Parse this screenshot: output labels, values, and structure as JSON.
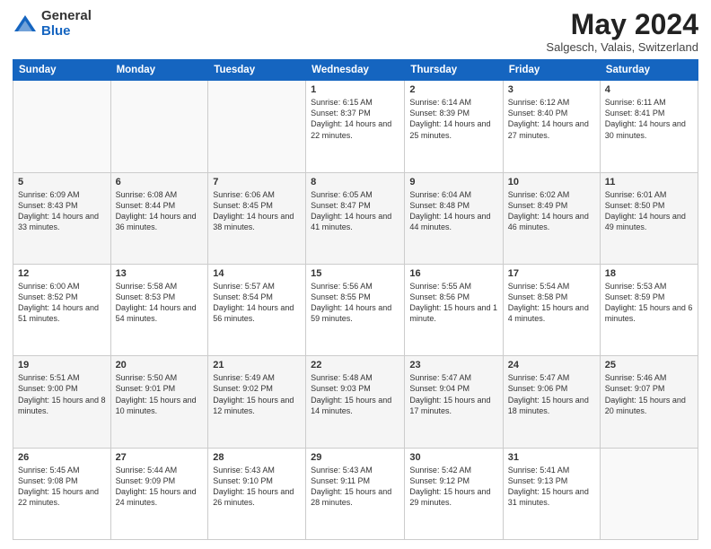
{
  "header": {
    "logo_general": "General",
    "logo_blue": "Blue",
    "month_title": "May 2024",
    "location": "Salgesch, Valais, Switzerland"
  },
  "days_of_week": [
    "Sunday",
    "Monday",
    "Tuesday",
    "Wednesday",
    "Thursday",
    "Friday",
    "Saturday"
  ],
  "weeks": [
    [
      {
        "day": "",
        "info": ""
      },
      {
        "day": "",
        "info": ""
      },
      {
        "day": "",
        "info": ""
      },
      {
        "day": "1",
        "info": "Sunrise: 6:15 AM\nSunset: 8:37 PM\nDaylight: 14 hours\nand 22 minutes."
      },
      {
        "day": "2",
        "info": "Sunrise: 6:14 AM\nSunset: 8:39 PM\nDaylight: 14 hours\nand 25 minutes."
      },
      {
        "day": "3",
        "info": "Sunrise: 6:12 AM\nSunset: 8:40 PM\nDaylight: 14 hours\nand 27 minutes."
      },
      {
        "day": "4",
        "info": "Sunrise: 6:11 AM\nSunset: 8:41 PM\nDaylight: 14 hours\nand 30 minutes."
      }
    ],
    [
      {
        "day": "5",
        "info": "Sunrise: 6:09 AM\nSunset: 8:43 PM\nDaylight: 14 hours\nand 33 minutes."
      },
      {
        "day": "6",
        "info": "Sunrise: 6:08 AM\nSunset: 8:44 PM\nDaylight: 14 hours\nand 36 minutes."
      },
      {
        "day": "7",
        "info": "Sunrise: 6:06 AM\nSunset: 8:45 PM\nDaylight: 14 hours\nand 38 minutes."
      },
      {
        "day": "8",
        "info": "Sunrise: 6:05 AM\nSunset: 8:47 PM\nDaylight: 14 hours\nand 41 minutes."
      },
      {
        "day": "9",
        "info": "Sunrise: 6:04 AM\nSunset: 8:48 PM\nDaylight: 14 hours\nand 44 minutes."
      },
      {
        "day": "10",
        "info": "Sunrise: 6:02 AM\nSunset: 8:49 PM\nDaylight: 14 hours\nand 46 minutes."
      },
      {
        "day": "11",
        "info": "Sunrise: 6:01 AM\nSunset: 8:50 PM\nDaylight: 14 hours\nand 49 minutes."
      }
    ],
    [
      {
        "day": "12",
        "info": "Sunrise: 6:00 AM\nSunset: 8:52 PM\nDaylight: 14 hours\nand 51 minutes."
      },
      {
        "day": "13",
        "info": "Sunrise: 5:58 AM\nSunset: 8:53 PM\nDaylight: 14 hours\nand 54 minutes."
      },
      {
        "day": "14",
        "info": "Sunrise: 5:57 AM\nSunset: 8:54 PM\nDaylight: 14 hours\nand 56 minutes."
      },
      {
        "day": "15",
        "info": "Sunrise: 5:56 AM\nSunset: 8:55 PM\nDaylight: 14 hours\nand 59 minutes."
      },
      {
        "day": "16",
        "info": "Sunrise: 5:55 AM\nSunset: 8:56 PM\nDaylight: 15 hours\nand 1 minute."
      },
      {
        "day": "17",
        "info": "Sunrise: 5:54 AM\nSunset: 8:58 PM\nDaylight: 15 hours\nand 4 minutes."
      },
      {
        "day": "18",
        "info": "Sunrise: 5:53 AM\nSunset: 8:59 PM\nDaylight: 15 hours\nand 6 minutes."
      }
    ],
    [
      {
        "day": "19",
        "info": "Sunrise: 5:51 AM\nSunset: 9:00 PM\nDaylight: 15 hours\nand 8 minutes."
      },
      {
        "day": "20",
        "info": "Sunrise: 5:50 AM\nSunset: 9:01 PM\nDaylight: 15 hours\nand 10 minutes."
      },
      {
        "day": "21",
        "info": "Sunrise: 5:49 AM\nSunset: 9:02 PM\nDaylight: 15 hours\nand 12 minutes."
      },
      {
        "day": "22",
        "info": "Sunrise: 5:48 AM\nSunset: 9:03 PM\nDaylight: 15 hours\nand 14 minutes."
      },
      {
        "day": "23",
        "info": "Sunrise: 5:47 AM\nSunset: 9:04 PM\nDaylight: 15 hours\nand 17 minutes."
      },
      {
        "day": "24",
        "info": "Sunrise: 5:47 AM\nSunset: 9:06 PM\nDaylight: 15 hours\nand 18 minutes."
      },
      {
        "day": "25",
        "info": "Sunrise: 5:46 AM\nSunset: 9:07 PM\nDaylight: 15 hours\nand 20 minutes."
      }
    ],
    [
      {
        "day": "26",
        "info": "Sunrise: 5:45 AM\nSunset: 9:08 PM\nDaylight: 15 hours\nand 22 minutes."
      },
      {
        "day": "27",
        "info": "Sunrise: 5:44 AM\nSunset: 9:09 PM\nDaylight: 15 hours\nand 24 minutes."
      },
      {
        "day": "28",
        "info": "Sunrise: 5:43 AM\nSunset: 9:10 PM\nDaylight: 15 hours\nand 26 minutes."
      },
      {
        "day": "29",
        "info": "Sunrise: 5:43 AM\nSunset: 9:11 PM\nDaylight: 15 hours\nand 28 minutes."
      },
      {
        "day": "30",
        "info": "Sunrise: 5:42 AM\nSunset: 9:12 PM\nDaylight: 15 hours\nand 29 minutes."
      },
      {
        "day": "31",
        "info": "Sunrise: 5:41 AM\nSunset: 9:13 PM\nDaylight: 15 hours\nand 31 minutes."
      },
      {
        "day": "",
        "info": ""
      }
    ]
  ]
}
